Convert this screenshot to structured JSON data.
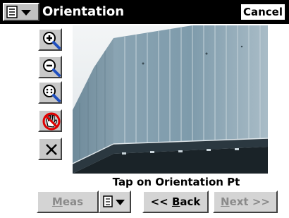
{
  "header": {
    "title": "Orientation",
    "cancel_label": "Cancel"
  },
  "tools": [
    {
      "name": "zoom-in"
    },
    {
      "name": "zoom-out"
    },
    {
      "name": "zoom-fit"
    },
    {
      "name": "pan-disabled"
    },
    {
      "name": "clear"
    }
  ],
  "status": {
    "message": "Tap on Orientation Pt"
  },
  "footer": {
    "meas_u": "M",
    "meas_rest": "eas",
    "back_pre": "<< ",
    "back_u": "B",
    "back_rest": "ack",
    "next_u": "N",
    "next_rest": "ext >>"
  },
  "colors": {
    "titlebar": "#000000",
    "facade": "#7e9bab",
    "sky": "#dde3e7"
  }
}
